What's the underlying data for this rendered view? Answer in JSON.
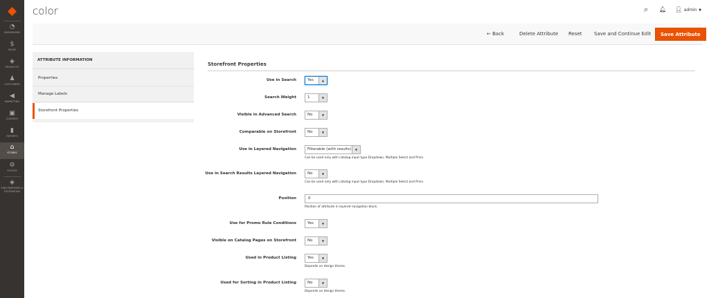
{
  "nav": {
    "items": [
      {
        "label": "DASHBOARD",
        "icon": "dashboard-icon",
        "glyph": "◔"
      },
      {
        "label": "SALES",
        "icon": "dollar-icon",
        "glyph": "$"
      },
      {
        "label": "PRODUCTS",
        "icon": "cube-icon",
        "glyph": "◈"
      },
      {
        "label": "CUSTOMERS",
        "icon": "person-icon",
        "glyph": "♟"
      },
      {
        "label": "MARKETING",
        "icon": "megaphone-icon",
        "glyph": "◀"
      },
      {
        "label": "CONTENT",
        "icon": "layout-icon",
        "glyph": "▣"
      },
      {
        "label": "REPORTS",
        "icon": "bar-chart-icon",
        "glyph": "▮"
      },
      {
        "label": "STORES",
        "icon": "store-icon",
        "glyph": "⌂"
      },
      {
        "label": "SYSTEM",
        "icon": "gear-icon",
        "glyph": "⚙"
      },
      {
        "label": "FIND PARTNERS & EXTENSIONS",
        "icon": "box-icon",
        "glyph": "◈"
      }
    ]
  },
  "header": {
    "title": "color",
    "user": "admin"
  },
  "actions": {
    "back": "Back",
    "delete": "Delete Attribute",
    "reset": "Reset",
    "save_continue": "Save and Continue Edit",
    "save": "Save Attribute"
  },
  "tabs": {
    "heading": "ATTRIBUTE INFORMATION",
    "items": [
      "Properties",
      "Manage Labels",
      "Storefront Properties"
    ]
  },
  "section": {
    "title": "Storefront Properties"
  },
  "fields": [
    {
      "label": "Use in Search",
      "value": "Yes"
    },
    {
      "label": "Search Weight",
      "value": "1"
    },
    {
      "label": "Visible in Advanced Search",
      "value": "No"
    },
    {
      "label": "Comparable on Storefront",
      "value": "No"
    },
    {
      "label": "Use in Layered Navigation",
      "value": "Filterable (with results)",
      "note": "Can be used only with catalog input type Dropdown, Multiple Select and Price."
    },
    {
      "label": "Use in Search Results Layered Navigation",
      "value": "No",
      "note": "Can be used only with catalog input type Dropdown, Multiple Select and Price."
    },
    {
      "label": "Position",
      "value": "0",
      "note": "Position of attribute in layered navigation block."
    },
    {
      "label": "Use for Promo Rule Conditions",
      "value": "Yes"
    },
    {
      "label": "Visible on Catalog Pages on Storefront",
      "value": "No"
    },
    {
      "label": "Used in Product Listing",
      "value": "Yes",
      "note": "Depends on design theme."
    },
    {
      "label": "Used for Sorting in Product Listing",
      "value": "No",
      "note": "Depends on design theme."
    }
  ]
}
